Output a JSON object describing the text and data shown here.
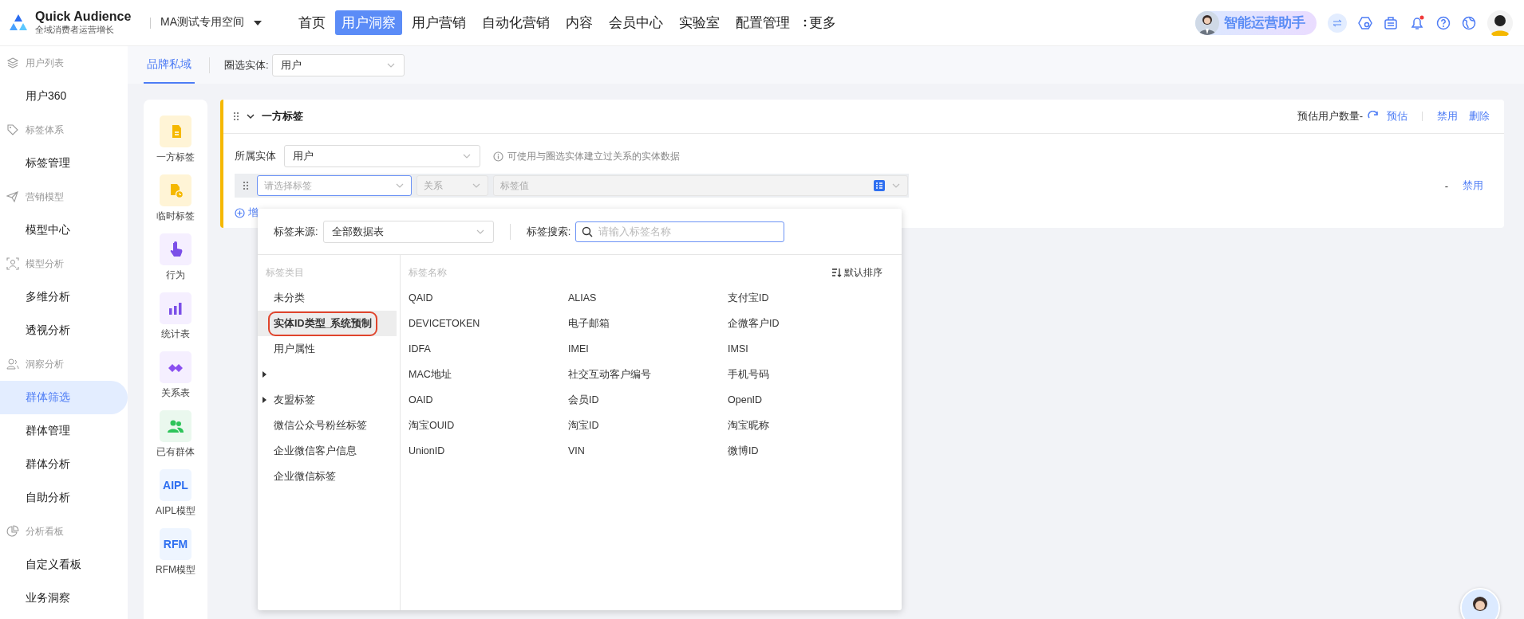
{
  "brand": {
    "name": "Quick Audience",
    "tagline": "全域消费者运营增长"
  },
  "workspace": {
    "label": "MA测试专用空间"
  },
  "nav": [
    {
      "label": "首页",
      "selected": false
    },
    {
      "label": "用户洞察",
      "selected": true
    },
    {
      "label": "用户营销",
      "selected": false
    },
    {
      "label": "自动化营销",
      "selected": false
    },
    {
      "label": "内容",
      "selected": false
    },
    {
      "label": "会员中心",
      "selected": false
    },
    {
      "label": "实验室",
      "selected": false
    },
    {
      "label": "配置管理",
      "selected": false
    }
  ],
  "more": {
    "label": "更多"
  },
  "assistant": {
    "label": "智能运营助手"
  },
  "notifications": {
    "unread": true
  },
  "sidebar": [
    {
      "label": "用户列表",
      "items": [
        {
          "label": "用户360",
          "selected": false
        }
      ]
    },
    {
      "label": "标签体系",
      "items": [
        {
          "label": "标签管理",
          "selected": false
        }
      ]
    },
    {
      "label": "营销模型",
      "items": [
        {
          "label": "模型中心",
          "selected": false
        }
      ]
    },
    {
      "label": "模型分析",
      "items": [
        {
          "label": "多维分析",
          "selected": false
        },
        {
          "label": "透视分析",
          "selected": false
        }
      ]
    },
    {
      "label": "洞察分析",
      "items": [
        {
          "label": "群体筛选",
          "selected": true
        },
        {
          "label": "群体管理",
          "selected": false
        },
        {
          "label": "群体分析",
          "selected": false
        },
        {
          "label": "自助分析",
          "selected": false
        }
      ]
    },
    {
      "label": "分析看板",
      "items": [
        {
          "label": "自定义看板",
          "selected": false
        },
        {
          "label": "业务洞察",
          "selected": false
        }
      ]
    }
  ],
  "tabs": [
    {
      "label": "品牌私域",
      "selected": true
    }
  ],
  "entity_filter": {
    "label": "圈选实体:",
    "value": "用户"
  },
  "palette": [
    {
      "label": "一方标签",
      "color": "#fff4d6"
    },
    {
      "label": "临时标签",
      "color": "#fff4d6"
    },
    {
      "label": "行为",
      "color": "#f5efff"
    },
    {
      "label": "统计表",
      "color": "#f5efff"
    },
    {
      "label": "关系表",
      "color": "#f5efff"
    },
    {
      "label": "已有群体",
      "color": "#eaf8ee"
    },
    {
      "label": "AIPL模型",
      "color": "#eef5ff",
      "badge": "AIPL"
    },
    {
      "label": "RFM模型",
      "color": "#eef5ff",
      "badge": "RFM"
    }
  ],
  "card": {
    "title": "一方标签",
    "expanded": true,
    "estimate_label": "预估用户数量-",
    "estimate_action": "预估",
    "actions": [
      "禁用",
      "删除"
    ],
    "entity_label": "所属实体",
    "entity_value": "用户",
    "entity_hint": "可使用与圈选实体建立过关系的实体数据",
    "condition": {
      "tag_placeholder": "请选择标签",
      "relation_placeholder": "关系",
      "value_placeholder": "标签值",
      "count": "-",
      "action": "禁用"
    },
    "add_label": "增"
  },
  "tag_picker": {
    "source_label": "标签来源:",
    "source_value": "全部数据表",
    "search_label": "标签搜索:",
    "search_placeholder": "请输入标签名称",
    "category_header": "标签类目",
    "name_header": "标签名称",
    "sort_label": "默认排序",
    "categories": [
      {
        "label": "未分类",
        "selected": false,
        "expandable": false
      },
      {
        "label": "实体ID类型_系统预制",
        "selected": true,
        "expandable": false
      },
      {
        "label": "用户属性",
        "selected": false,
        "expandable": false
      },
      {
        "selected": false,
        "expandable": true
      },
      {
        "label": "友盟标签",
        "selected": false,
        "expandable": true
      },
      {
        "label": "微信公众号粉丝标签",
        "selected": false,
        "expandable": false
      },
      {
        "label": "企业微信客户信息",
        "selected": false,
        "expandable": false
      },
      {
        "label": "企业微信标签",
        "selected": false,
        "expandable": false
      }
    ],
    "names": [
      "QAID",
      "ALIAS",
      "支付宝ID",
      "DEVICETOKEN",
      "电子邮箱",
      "企微客户ID",
      "IDFA",
      "IMEI",
      "IMSI",
      "MAC地址",
      "社交互动客户编号",
      "手机号码",
      "OAID",
      "会员ID",
      "OpenID",
      "淘宝OUID",
      "淘宝ID",
      "淘宝昵称",
      "UnionID",
      "VIN",
      "微博ID"
    ]
  }
}
